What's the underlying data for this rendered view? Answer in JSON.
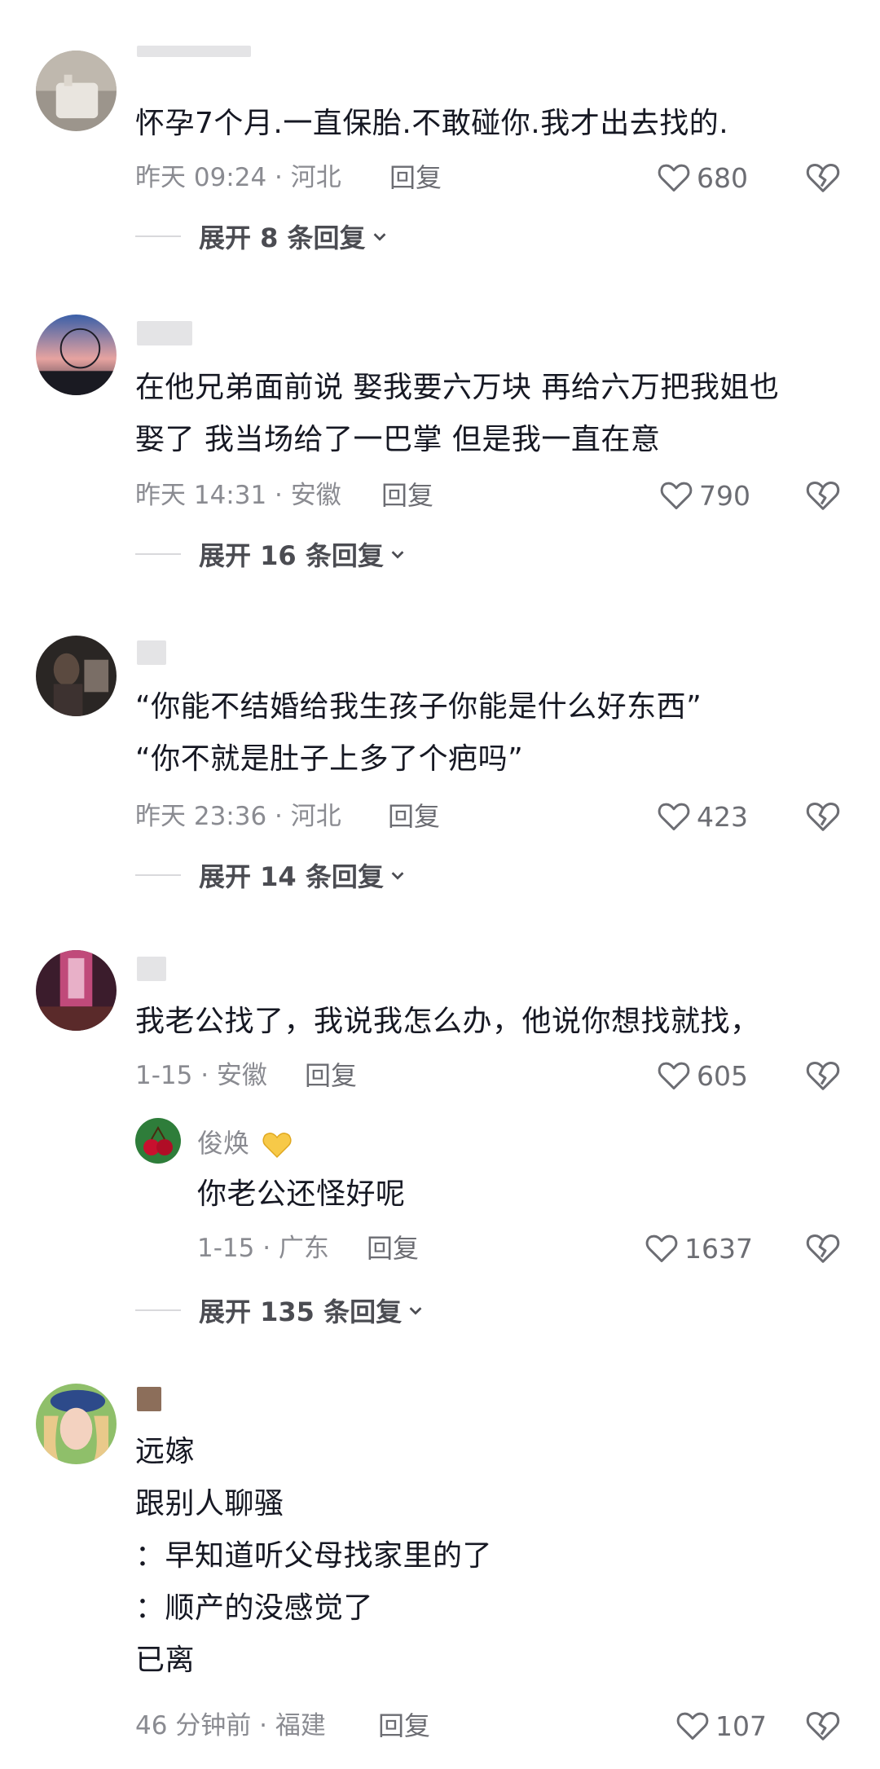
{
  "comments": [
    {
      "lines": [
        "怀孕7个月.一直保胎.不敢碰你.我才出去找的."
      ],
      "meta": "昨天 09:24 · 河北",
      "reply": "回复",
      "likes": "680",
      "expand": "展开 8 条回复"
    },
    {
      "lines": [
        "在他兄弟面前说 娶我要六万块 再给六万把我姐也",
        "娶了 我当场给了一巴掌  但是我一直在意"
      ],
      "meta": "昨天 14:31 · 安徽",
      "reply": "回复",
      "likes": "790",
      "expand": "展开 16 条回复"
    },
    {
      "lines": [
        "“你能不结婚给我生孩子你能是什么好东西”",
        "“你不就是肚子上多了个疤吗”"
      ],
      "meta": "昨天 23:36 · 河北",
      "reply": "回复",
      "likes": "423",
      "expand": "展开 14 条回复"
    },
    {
      "lines": [
        "我老公找了，我说我怎么办，他说你想找就找，"
      ],
      "meta": "1-15 · 安徽",
      "reply": "回复",
      "likes": "605",
      "sub_reply": {
        "name": "俊焕",
        "text": "你老公还怪好呢",
        "meta": "1-15 · 广东",
        "reply": "回复",
        "likes": "1637"
      },
      "expand": "展开 135 条回复"
    },
    {
      "lines": [
        "远嫁",
        "跟别人聊骚",
        "：早知道听父母找家里的了",
        "：顺产的没感觉了",
        "已离"
      ],
      "meta": "46 分钟前 · 福建",
      "reply": "回复",
      "likes": "107"
    }
  ],
  "icons": {
    "like": "heart-outline-icon",
    "dislike": "broken-heart-icon",
    "expand": "chevron-down-icon",
    "badge": "yellow-heart-icon"
  },
  "colors": {
    "text": "#161823",
    "meta": "#8a8b91",
    "secondary": "#6c6d73",
    "blur": "#e4e4e6",
    "yellow_heart": "#f7c948"
  }
}
